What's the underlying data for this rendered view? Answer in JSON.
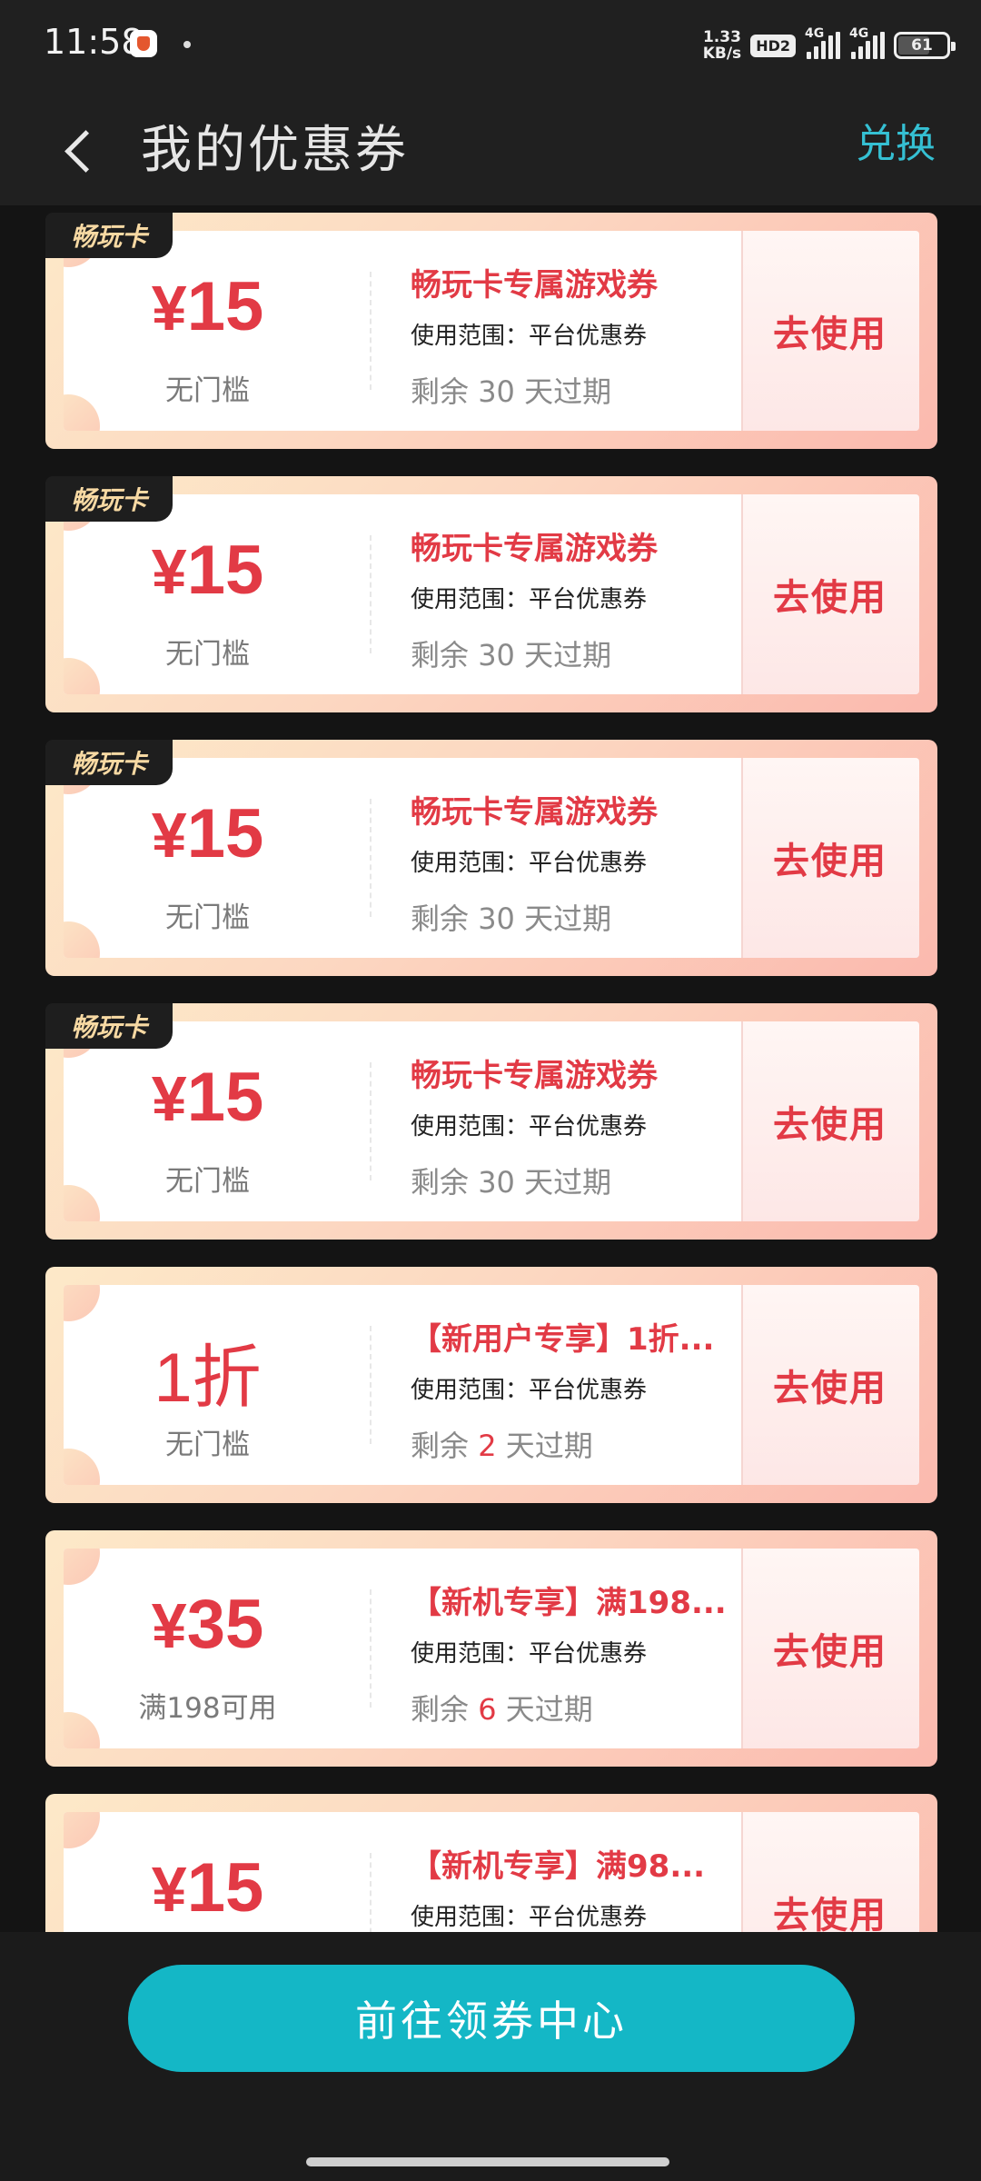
{
  "status_bar": {
    "time": "11:58",
    "net_speed_value": "1.33",
    "net_speed_unit": "KB/s",
    "hd": "HD2",
    "sig1_label": "4G",
    "sig2_label": "4G",
    "battery": "61"
  },
  "header": {
    "title": "我的优惠券",
    "action": "兑换"
  },
  "coupons": [
    {
      "tag": "畅玩卡",
      "yen": "¥",
      "amount": "15",
      "threshold": "无门槛",
      "title": "畅玩卡专属游戏券",
      "scope": "使用范围：平台优惠券",
      "expiry_prefix": "剩余",
      "expiry_days": "30",
      "expiry_suffix": "天过期",
      "action": "去使用"
    },
    {
      "tag": "畅玩卡",
      "yen": "¥",
      "amount": "15",
      "threshold": "无门槛",
      "title": "畅玩卡专属游戏券",
      "scope": "使用范围：平台优惠券",
      "expiry_prefix": "剩余",
      "expiry_days": "30",
      "expiry_suffix": "天过期",
      "action": "去使用"
    },
    {
      "tag": "畅玩卡",
      "yen": "¥",
      "amount": "15",
      "threshold": "无门槛",
      "title": "畅玩卡专属游戏券",
      "scope": "使用范围：平台优惠券",
      "expiry_prefix": "剩余",
      "expiry_days": "30",
      "expiry_suffix": "天过期",
      "action": "去使用"
    },
    {
      "tag": "畅玩卡",
      "yen": "¥",
      "amount": "15",
      "threshold": "无门槛",
      "title": "畅玩卡专属游戏券",
      "scope": "使用范围：平台优惠券",
      "expiry_prefix": "剩余",
      "expiry_days": "30",
      "expiry_suffix": "天过期",
      "action": "去使用"
    },
    {
      "amount": "1折",
      "threshold": "无门槛",
      "title": "【新用户专享】1折...",
      "scope": "使用范围：平台优惠券",
      "expiry_prefix": "剩余",
      "expiry_days": "2",
      "expiry_suffix": "天过期",
      "action": "去使用"
    },
    {
      "yen": "¥",
      "amount": "35",
      "threshold": "满198可用",
      "title": "【新机专享】满198...",
      "scope": "使用范围：平台优惠券",
      "expiry_prefix": "剩余",
      "expiry_days": "6",
      "expiry_suffix": "天过期",
      "action": "去使用"
    },
    {
      "yen": "¥",
      "amount": "15",
      "title": "【新机专享】满98...",
      "scope": "使用范围：平台优惠券",
      "action": "去使用"
    }
  ],
  "footer": {
    "button": "前往领券中心"
  }
}
